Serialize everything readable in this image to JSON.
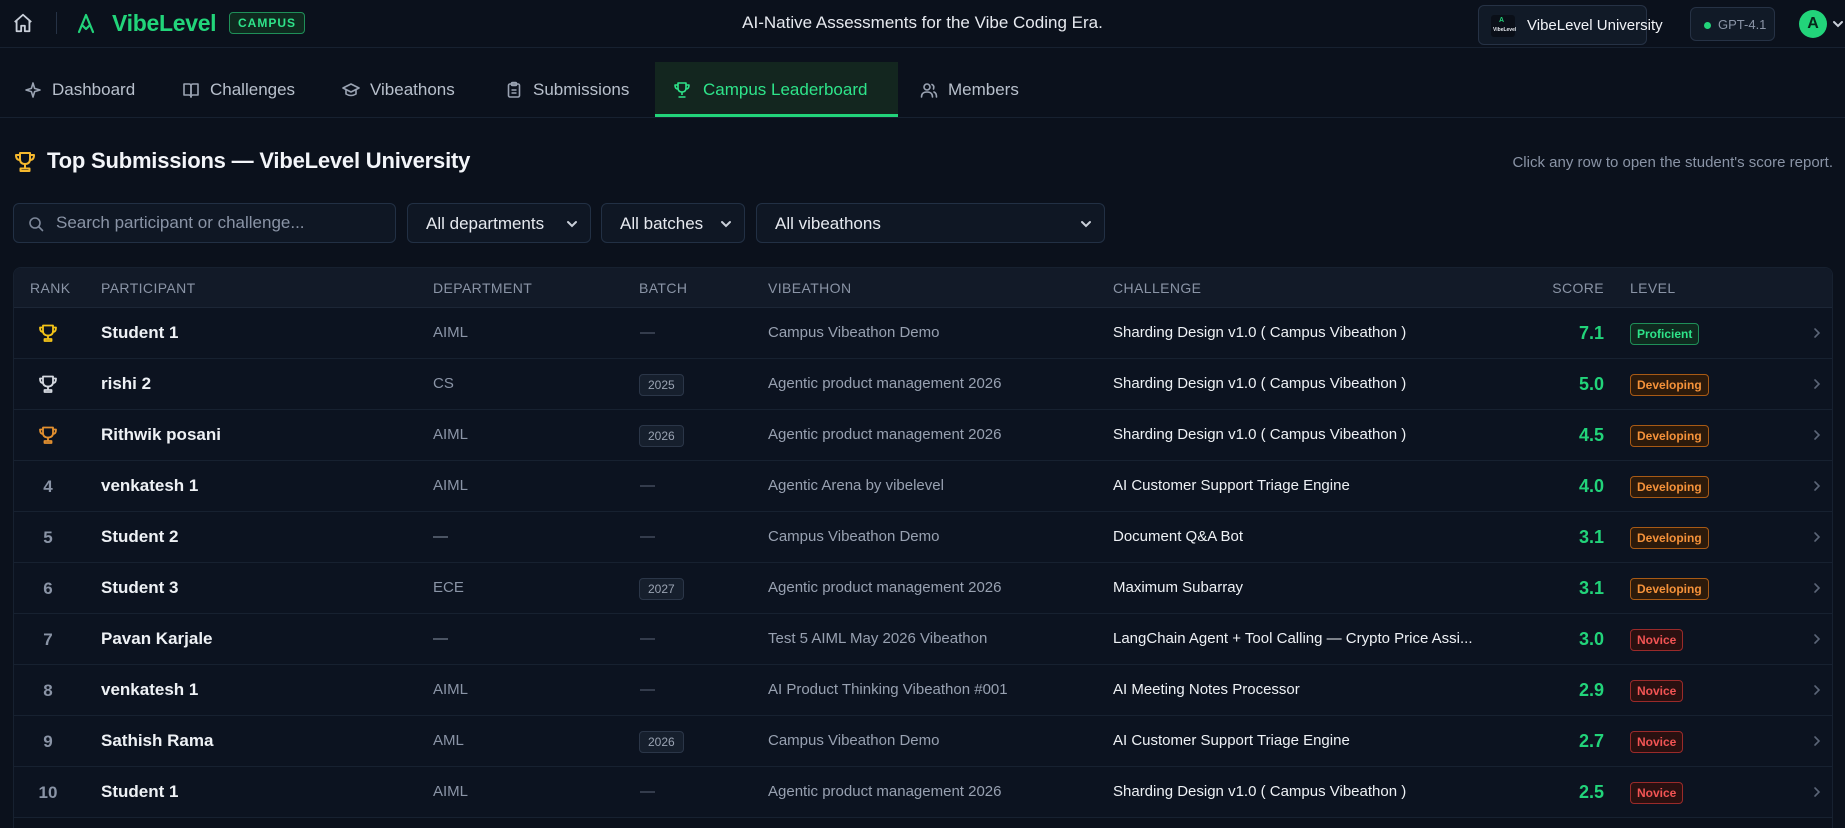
{
  "header": {
    "brand": "VibeLevel",
    "badge": "CAMPUS",
    "tagline": "AI-Native Assessments for the Vibe Coding Era.",
    "university": "VibeLevel University",
    "university_logo_text": "VibeLevel",
    "model": "GPT-4.1",
    "avatar_initial": "A",
    "accent_color": "#22d47a"
  },
  "tabs": [
    {
      "label": "Dashboard",
      "icon": "sparkle-icon"
    },
    {
      "label": "Challenges",
      "icon": "book-icon"
    },
    {
      "label": "Vibeathons",
      "icon": "graduation-cap-icon"
    },
    {
      "label": "Submissions",
      "icon": "clipboard-icon"
    },
    {
      "label": "Campus Leaderboard",
      "icon": "trophy-icon",
      "active": true
    },
    {
      "label": "Members",
      "icon": "users-icon"
    }
  ],
  "page": {
    "title": "Top Submissions — VibeLevel University",
    "hint": "Click any row to open the student's score report."
  },
  "filters": {
    "search_placeholder": "Search participant or challenge...",
    "department": "All departments",
    "batch": "All batches",
    "vibeathon": "All vibeathons"
  },
  "table": {
    "columns": [
      "RANK",
      "PARTICIPANT",
      "DEPARTMENT",
      "BATCH",
      "VIBEATHON",
      "CHALLENGE",
      "SCORE",
      "LEVEL"
    ],
    "rows": [
      {
        "rank": "",
        "trophy": "gold",
        "participant": "Student 1",
        "department": "AIML",
        "batch": "—",
        "vibeathon": "Campus Vibeathon Demo",
        "challenge": "Sharding Design v1.0 ( Campus Vibeathon )",
        "score": "7.1",
        "level": "Proficient"
      },
      {
        "rank": "",
        "trophy": "silver",
        "participant": "rishi 2",
        "department": "CS",
        "batch": "2025",
        "vibeathon": "Agentic product management 2026",
        "challenge": "Sharding Design v1.0 ( Campus Vibeathon )",
        "score": "5.0",
        "level": "Developing"
      },
      {
        "rank": "",
        "trophy": "bronze",
        "participant": "Rithwik posani",
        "department": "AIML",
        "batch": "2026",
        "vibeathon": "Agentic product management 2026",
        "challenge": "Sharding Design v1.0 ( Campus Vibeathon )",
        "score": "4.5",
        "level": "Developing"
      },
      {
        "rank": "4",
        "participant": "venkatesh 1",
        "department": "AIML",
        "batch": "—",
        "vibeathon": "Agentic Arena by vibelevel",
        "challenge": "AI Customer Support Triage Engine",
        "score": "4.0",
        "level": "Developing"
      },
      {
        "rank": "5",
        "participant": "Student 2",
        "department": "—",
        "batch": "—",
        "vibeathon": "Campus Vibeathon Demo",
        "challenge": "Document Q&A Bot",
        "score": "3.1",
        "level": "Developing"
      },
      {
        "rank": "6",
        "participant": "Student 3",
        "department": "ECE",
        "batch": "2027",
        "vibeathon": "Agentic product management 2026",
        "challenge": "Maximum Subarray",
        "score": "3.1",
        "level": "Developing"
      },
      {
        "rank": "7",
        "participant": "Pavan Karjale",
        "department": "—",
        "batch": "—",
        "vibeathon": "Test 5 AIML May 2026 Vibeathon",
        "challenge": "LangChain Agent + Tool Calling — Crypto Price Assi...",
        "score": "3.0",
        "level": "Novice"
      },
      {
        "rank": "8",
        "participant": "venkatesh 1",
        "department": "AIML",
        "batch": "—",
        "vibeathon": "AI Product Thinking Vibeathon #001",
        "challenge": "AI Meeting Notes Processor",
        "score": "2.9",
        "level": "Novice"
      },
      {
        "rank": "9",
        "participant": "Sathish Rama",
        "department": "AML",
        "batch": "2026",
        "vibeathon": "Campus Vibeathon Demo",
        "challenge": "AI Customer Support Triage Engine",
        "score": "2.7",
        "level": "Novice"
      },
      {
        "rank": "10",
        "participant": "Student 1",
        "department": "AIML",
        "batch": "—",
        "vibeathon": "Agentic product management 2026",
        "challenge": "Sharding Design v1.0 ( Campus Vibeathon )",
        "score": "2.5",
        "level": "Novice"
      }
    ]
  },
  "colors": {
    "gold": "#f5c518",
    "silver": "#d5d9e0",
    "bronze": "#e3902f",
    "proficient": "#2ee48a",
    "developing": "#f5923a",
    "novice": "#f25454"
  }
}
